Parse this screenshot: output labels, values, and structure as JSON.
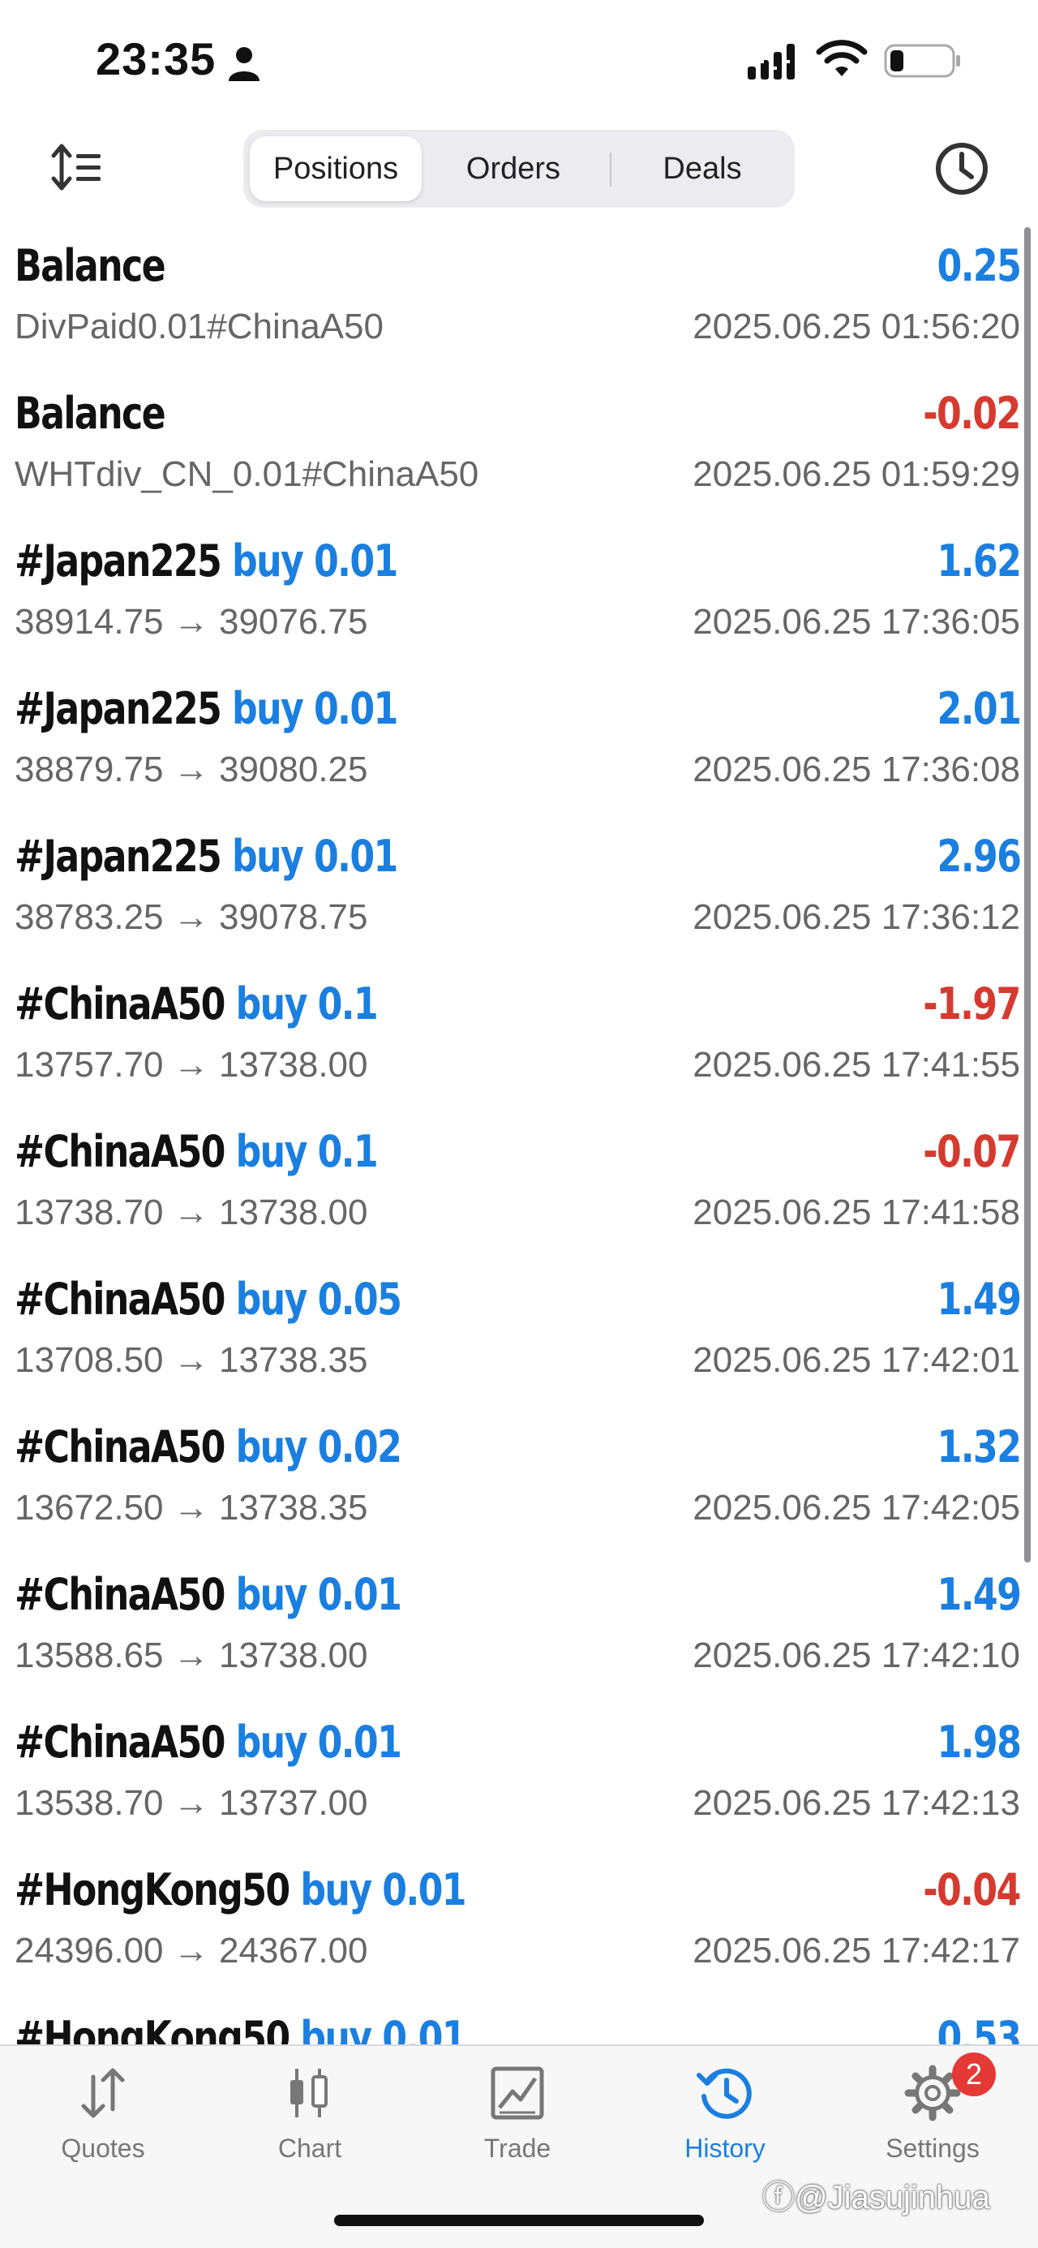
{
  "status_bar": {
    "time": "23:35",
    "icons": [
      "person-icon",
      "signal-icon",
      "wifi-icon",
      "battery-icon"
    ]
  },
  "toolbar": {
    "tabs": [
      {
        "label": "Positions",
        "active": true
      },
      {
        "label": "Orders",
        "active": false
      },
      {
        "label": "Deals",
        "active": false
      }
    ],
    "icons": [
      "sort-icon",
      "clock-icon"
    ]
  },
  "deals": [
    {
      "symbol": "Balance",
      "direction": "",
      "detail": "DivPaid0.01#ChinaA50",
      "profit": "0.25",
      "time": "2025.06.25 01:56:20"
    },
    {
      "symbol": "Balance",
      "direction": "",
      "detail": "WHTdiv_CN_0.01#ChinaA50",
      "profit": "-0.02",
      "time": "2025.06.25 01:59:29"
    },
    {
      "symbol": "#Japan225",
      "direction": "buy 0.01",
      "detail": "38914.75 → 39076.75",
      "profit": "1.62",
      "time": "2025.06.25 17:36:05"
    },
    {
      "symbol": "#Japan225",
      "direction": "buy 0.01",
      "detail": "38879.75 → 39080.25",
      "profit": "2.01",
      "time": "2025.06.25 17:36:08"
    },
    {
      "symbol": "#Japan225",
      "direction": "buy 0.01",
      "detail": "38783.25 → 39078.75",
      "profit": "2.96",
      "time": "2025.06.25 17:36:12"
    },
    {
      "symbol": "#ChinaA50",
      "direction": "buy 0.1",
      "detail": "13757.70 → 13738.00",
      "profit": "-1.97",
      "time": "2025.06.25 17:41:55"
    },
    {
      "symbol": "#ChinaA50",
      "direction": "buy 0.1",
      "detail": "13738.70 → 13738.00",
      "profit": "-0.07",
      "time": "2025.06.25 17:41:58"
    },
    {
      "symbol": "#ChinaA50",
      "direction": "buy 0.05",
      "detail": "13708.50 → 13738.35",
      "profit": "1.49",
      "time": "2025.06.25 17:42:01"
    },
    {
      "symbol": "#ChinaA50",
      "direction": "buy 0.02",
      "detail": "13672.50 → 13738.35",
      "profit": "1.32",
      "time": "2025.06.25 17:42:05"
    },
    {
      "symbol": "#ChinaA50",
      "direction": "buy 0.01",
      "detail": "13588.65 → 13738.00",
      "profit": "1.49",
      "time": "2025.06.25 17:42:10"
    },
    {
      "symbol": "#ChinaA50",
      "direction": "buy 0.01",
      "detail": "13538.70 → 13737.00",
      "profit": "1.98",
      "time": "2025.06.25 17:42:13"
    },
    {
      "symbol": "#HongKong50",
      "direction": "buy 0.01",
      "detail": "24396.00 → 24367.00",
      "profit": "-0.04",
      "time": "2025.06.25 17:42:17"
    },
    {
      "symbol": "#HongKong50",
      "direction": "buy 0.01",
      "detail": "",
      "profit": "0.53",
      "time": ""
    }
  ],
  "tab_bar": {
    "tabs": [
      {
        "label": "Quotes",
        "icon": "quotes-icon",
        "active": false
      },
      {
        "label": "Chart",
        "icon": "chart-icon",
        "active": false
      },
      {
        "label": "Trade",
        "icon": "trade-icon",
        "active": false
      },
      {
        "label": "History",
        "icon": "history-icon",
        "active": true
      },
      {
        "label": "Settings",
        "icon": "settings-icon",
        "active": false
      }
    ],
    "settings_badge": "2"
  },
  "watermark": "ⓕ@Jiasujinhua",
  "colors": {
    "accent_blue": "#1a7fe0",
    "loss_red": "#d63a2f",
    "secondary_text": "#666666",
    "badge_red": "#e53935"
  }
}
